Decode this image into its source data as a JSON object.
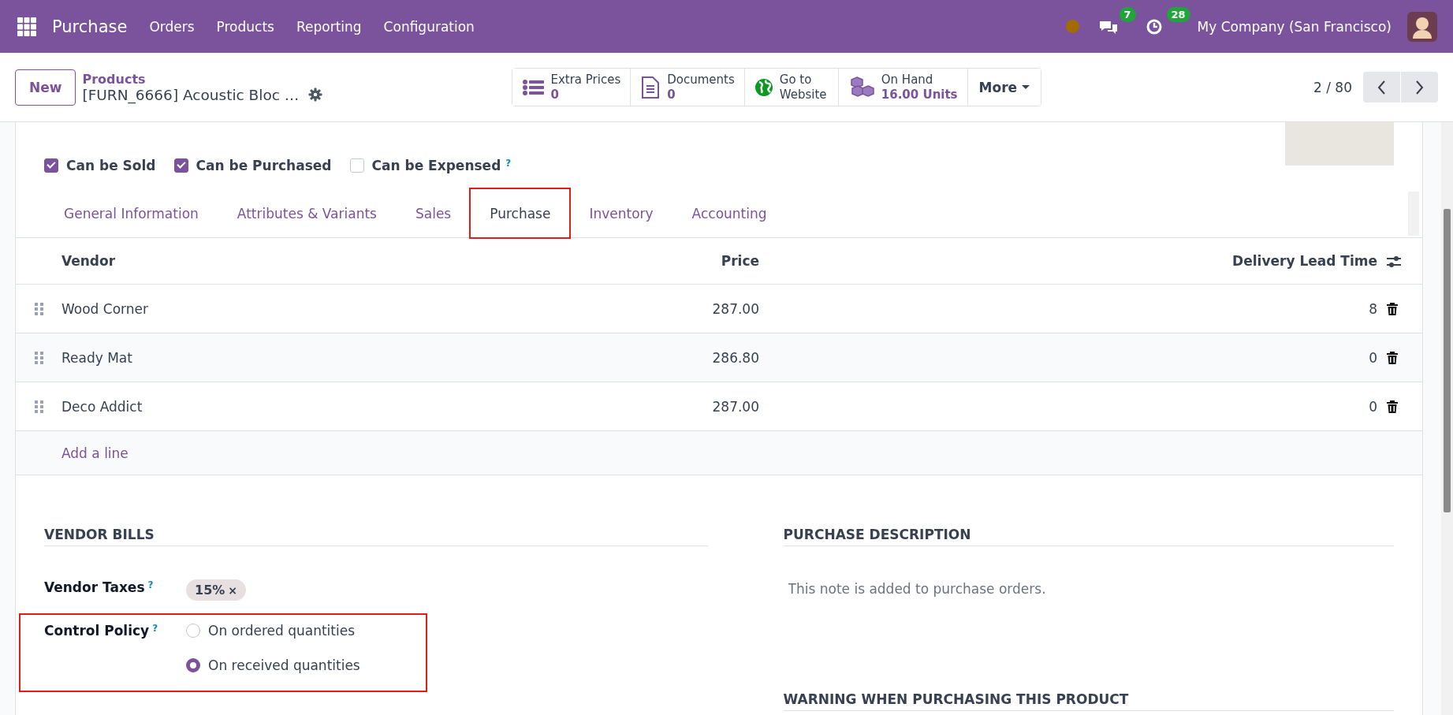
{
  "navbar": {
    "app": "Purchase",
    "menu": [
      "Orders",
      "Products",
      "Reporting",
      "Configuration"
    ],
    "messages_count": "7",
    "activities_count": "28",
    "company": "My Company (San Francisco)"
  },
  "control_panel": {
    "new_button": "New",
    "breadcrumb": "Products",
    "record_title": "[FURN_6666] Acoustic Bloc …",
    "smart_buttons": [
      {
        "kind": "list",
        "label": "Extra Prices",
        "value": "0"
      },
      {
        "kind": "document",
        "label": "Documents",
        "value": "0"
      },
      {
        "kind": "globe",
        "label": "Go to Website"
      },
      {
        "kind": "boxes",
        "label": "On Hand",
        "value": "16.00 Units"
      }
    ],
    "more_button": "More",
    "pager": "2 / 80"
  },
  "options": [
    {
      "label": "Can be Sold",
      "checked": true
    },
    {
      "label": "Can be Purchased",
      "checked": true
    },
    {
      "label": "Can be Expensed",
      "checked": false,
      "help": "?"
    }
  ],
  "tabs": [
    {
      "label": "General Information",
      "selected": false,
      "highlighted": false
    },
    {
      "label": "Attributes & Variants",
      "selected": false,
      "highlighted": false
    },
    {
      "label": "Sales",
      "selected": false,
      "highlighted": false
    },
    {
      "label": "Purchase",
      "selected": true,
      "highlighted": true
    },
    {
      "label": "Inventory",
      "selected": false,
      "highlighted": false
    },
    {
      "label": "Accounting",
      "selected": false,
      "highlighted": false
    }
  ],
  "vendor_table": {
    "columns": [
      "Vendor",
      "Price",
      "Delivery Lead Time"
    ],
    "rows": [
      {
        "vendor": "Wood Corner",
        "price": "287.00",
        "lead_time": "8"
      },
      {
        "vendor": "Ready Mat",
        "price": "286.80",
        "lead_time": "0"
      },
      {
        "vendor": "Deco Addict",
        "price": "287.00",
        "lead_time": "0"
      }
    ],
    "add_line": "Add a line"
  },
  "vendor_bills": {
    "heading": "VENDOR BILLS",
    "vendor_taxes": {
      "label": "Vendor Taxes",
      "help": "?",
      "tags": [
        {
          "label": "15%",
          "remove": "×"
        }
      ]
    },
    "control_policy": {
      "label": "Control Policy",
      "help": "?",
      "highlighted": true,
      "options": [
        {
          "label": "On ordered quantities",
          "selected": false
        },
        {
          "label": "On received quantities",
          "selected": true
        }
      ]
    }
  },
  "purchase_description": {
    "heading": "PURCHASE DESCRIPTION",
    "placeholder": "This note is added to purchase orders."
  },
  "warning": {
    "heading": "WARNING WHEN PURCHASING THIS PRODUCT"
  }
}
